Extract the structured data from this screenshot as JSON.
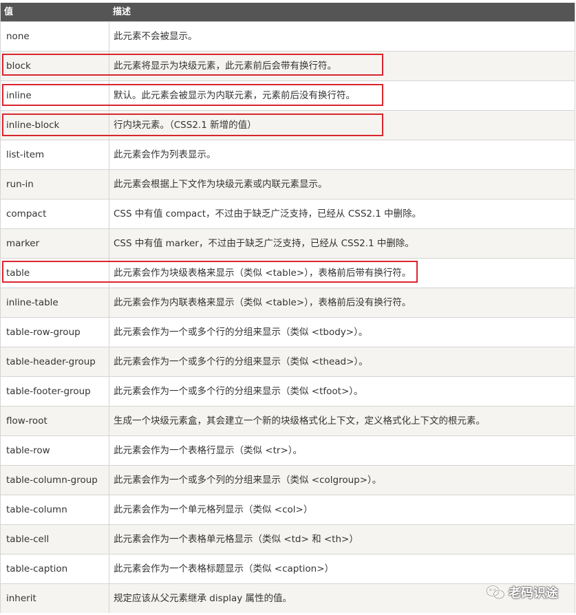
{
  "header": {
    "col_value": "值",
    "col_desc": "描述"
  },
  "rows": [
    {
      "value": "none",
      "desc": "此元素不会被显示。"
    },
    {
      "value": "block",
      "desc": "此元素将显示为块级元素，此元素前后会带有换行符。"
    },
    {
      "value": "inline",
      "desc": "默认。此元素会被显示为内联元素，元素前后没有换行符。"
    },
    {
      "value": "inline-block",
      "desc": "行内块元素。（CSS2.1 新增的值）"
    },
    {
      "value": "list-item",
      "desc": "此元素会作为列表显示。"
    },
    {
      "value": "run-in",
      "desc": "此元素会根据上下文作为块级元素或内联元素显示。"
    },
    {
      "value": "compact",
      "desc": "CSS 中有值 compact，不过由于缺乏广泛支持，已经从 CSS2.1 中删除。"
    },
    {
      "value": "marker",
      "desc": "CSS 中有值 marker，不过由于缺乏广泛支持，已经从 CSS2.1 中删除。"
    },
    {
      "value": "table",
      "desc": "此元素会作为块级表格来显示（类似 <table>），表格前后带有换行符。"
    },
    {
      "value": "inline-table",
      "desc": "此元素会作为内联表格来显示（类似 <table>），表格前后没有换行符。"
    },
    {
      "value": "table-row-group",
      "desc": "此元素会作为一个或多个行的分组来显示（类似 <tbody>）。"
    },
    {
      "value": "table-header-group",
      "desc": "此元素会作为一个或多个行的分组来显示（类似 <thead>）。"
    },
    {
      "value": "table-footer-group",
      "desc": "此元素会作为一个或多个行的分组来显示（类似 <tfoot>）。"
    },
    {
      "value": "flow-root",
      "desc": "生成一个块级元素盒，其会建立一个新的块级格式化上下文，定义格式化上下文的根元素。"
    },
    {
      "value": "table-row",
      "desc": "此元素会作为一个表格行显示（类似 <tr>）。"
    },
    {
      "value": "table-column-group",
      "desc": "此元素会作为一个或多个列的分组来显示（类似 <colgroup>）。"
    },
    {
      "value": "table-column",
      "desc": "此元素会作为一个单元格列显示（类似 <col>）"
    },
    {
      "value": "table-cell",
      "desc": "此元素会作为一个表格单元格显示（类似 <td> 和 <th>）"
    },
    {
      "value": "table-caption",
      "desc": "此元素会作为一个表格标题显示（类似 <caption>）"
    },
    {
      "value": "inherit",
      "desc": "规定应该从父元素继承 display 属性的值。"
    }
  ],
  "watermark": {
    "text": "老码识途"
  },
  "colors": {
    "header_bg": "#555555",
    "row_alt_bg": "#f6f4f0",
    "highlight": "#d9252e"
  }
}
